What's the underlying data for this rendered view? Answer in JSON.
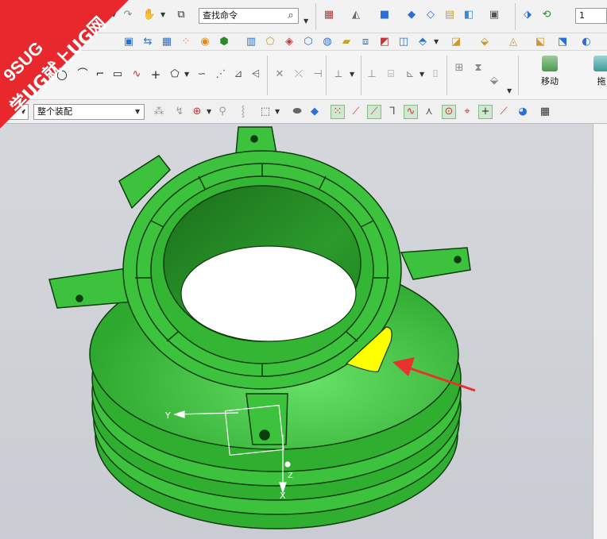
{
  "toolbar": {
    "search_value": "查找命令",
    "layer_value": "1",
    "filter_value": "整个装配",
    "move_label": "移动",
    "drag_label": "拖"
  },
  "icons": [
    "search-icon",
    "layer-icon",
    "block-icon",
    "cylinder-icon",
    "extrude-icon",
    "revolve-icon",
    "sketch-icon",
    "line-icon",
    "circle-icon",
    "arc-icon",
    "rectangle-icon",
    "point-icon",
    "trim-icon",
    "selection-icon",
    "snap-icon",
    "csys-icon",
    "move-icon"
  ],
  "viewport": {
    "axis_y": "Y",
    "axis_z": "Z",
    "axis_x": "X"
  },
  "watermark": {
    "line1": "9SUG",
    "line2": "学UG就上UG网"
  },
  "colors": {
    "model_green": "#3fc43f",
    "model_dark": "#1a7a1a",
    "highlight": "#ffff00",
    "arrow": "#e8322e",
    "watermark_red": "#e8282d"
  }
}
